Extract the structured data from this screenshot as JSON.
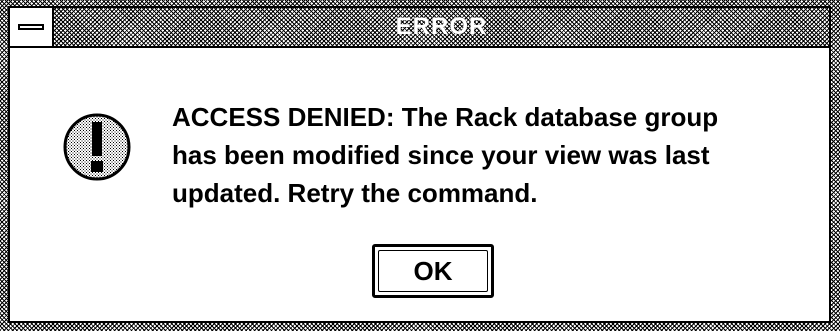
{
  "dialog": {
    "title": "ERROR",
    "icon": "exclamation-icon",
    "message": "ACCESS DENIED: The Rack database group\nhas been modified since your view was last\nupdated.  Retry the command.",
    "ok_label": "OK"
  },
  "colors": {
    "frame": "#000000",
    "background": "#ffffff"
  }
}
